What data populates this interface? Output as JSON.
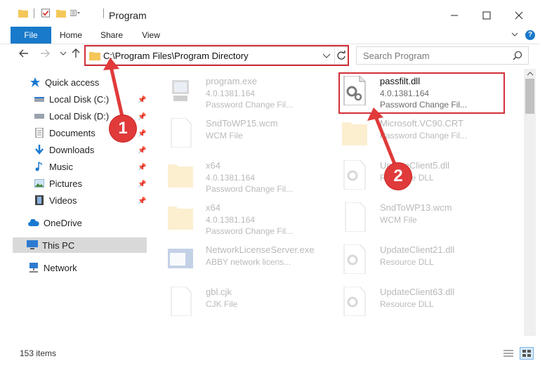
{
  "window": {
    "title": "Program"
  },
  "ribbon": {
    "tabs": [
      "File",
      "Home",
      "Share",
      "View"
    ]
  },
  "address": {
    "path": "C:\\Program Files\\Program Directory"
  },
  "search": {
    "placeholder": "Search Program"
  },
  "sidebar": {
    "items": [
      {
        "label": "Quick access",
        "icon": "star-icon"
      },
      {
        "label": "Local Disk (C:)",
        "icon": "drive-icon"
      },
      {
        "label": "Local Disk (D:)",
        "icon": "drive-icon"
      },
      {
        "label": "Documents",
        "icon": "documents-icon"
      },
      {
        "label": "Downloads",
        "icon": "download-icon"
      },
      {
        "label": "Music",
        "icon": "music-icon"
      },
      {
        "label": "Pictures",
        "icon": "pictures-icon"
      },
      {
        "label": "Videos",
        "icon": "videos-icon"
      },
      {
        "label": "OneDrive",
        "icon": "cloud-icon"
      },
      {
        "label": "This PC",
        "icon": "computer-icon"
      },
      {
        "label": "Network",
        "icon": "network-icon"
      }
    ]
  },
  "files": [
    {
      "name": "program.exe",
      "line1": "4.0.1381.164",
      "line2": "Password Change Fil..."
    },
    {
      "name": "passfilt.dll",
      "line1": "4.0.1381.164",
      "line2": "Password Change Fil..."
    },
    {
      "name": "SndToWP15.wcm",
      "line1": "WCM File",
      "line2": ""
    },
    {
      "name": "Microsoft.VC90.CRT",
      "line1": "Password Change Fil...",
      "line2": ""
    },
    {
      "name": "x64",
      "line1": "4.0.1381.164",
      "line2": "Password Change Fil..."
    },
    {
      "name": "UpdateClient5.dll",
      "line1": "Resource DLL",
      "line2": ""
    },
    {
      "name": "x64",
      "line1": "4.0.1381.164",
      "line2": "Password Change Fil..."
    },
    {
      "name": "SndToWP13.wcm",
      "line1": "WCM File",
      "line2": ""
    },
    {
      "name": "NetworkLicenseServer.exe",
      "line1": "ABBY network licens...",
      "line2": ""
    },
    {
      "name": "UpdateClient21.dll",
      "line1": "Resource DLL",
      "line2": ""
    },
    {
      "name": "gbl.cjk",
      "line1": "CJK File",
      "line2": ""
    },
    {
      "name": "UpdateClient63.dll",
      "line1": "Resource DLL",
      "line2": ""
    }
  ],
  "status": {
    "item_count": "153 items"
  },
  "callouts": [
    "1",
    "2"
  ],
  "colors": {
    "accent": "#1979ca",
    "highlight": "#d32f3a",
    "folder": "#f5c75a"
  }
}
